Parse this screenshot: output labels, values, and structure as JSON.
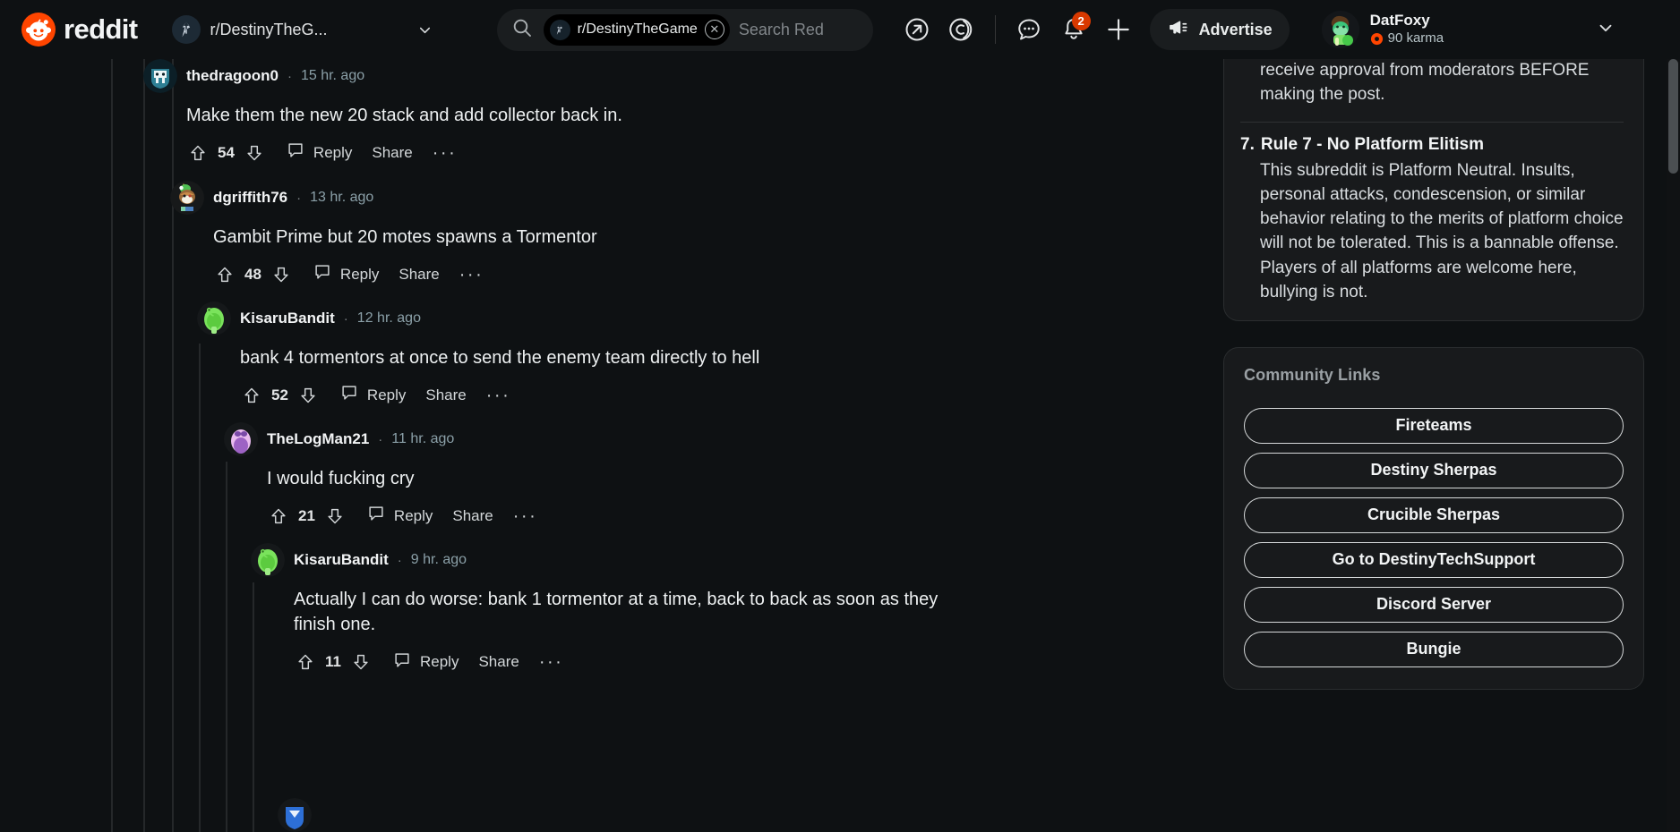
{
  "header": {
    "brand": "reddit",
    "community": {
      "name": "r/DestinyTheG...",
      "icon": "destiny-icon"
    },
    "search": {
      "pill_label": "r/DestinyTheGame",
      "placeholder": "Search Red",
      "value": ""
    },
    "icons": {
      "open_external": "external-link-icon",
      "reddit_coin": "reddit-coin-icon",
      "chat": "chat-bubble-icon",
      "notifications": "bell-icon",
      "create": "plus-icon"
    },
    "notifications_count": "2",
    "advertise_label": "Advertise",
    "user": {
      "name": "DatFoxy",
      "karma": "90 karma"
    }
  },
  "comments": [
    {
      "id": "c1",
      "author": "thedragoon0",
      "sep": "·",
      "time": "15 hr. ago",
      "body": "Make them the new 20 stack and add collector back in.",
      "score": "54",
      "reply_label": "Reply",
      "share_label": "Share",
      "more_label": "···",
      "depth": 0,
      "avatar_color": "#2a5b68"
    },
    {
      "id": "c2",
      "author": "dgriffith76",
      "sep": "·",
      "time": "13 hr. ago",
      "body": "Gambit Prime but 20 motes spawns a Tormentor",
      "score": "48",
      "reply_label": "Reply",
      "share_label": "Share",
      "more_label": "···",
      "depth": 1,
      "avatar_color": "#8a6038"
    },
    {
      "id": "c3",
      "author": "KisaruBandit",
      "sep": "·",
      "time": "12 hr. ago",
      "body": "bank 4 tormentors at once to send the enemy team directly to hell",
      "score": "52",
      "reply_label": "Reply",
      "share_label": "Share",
      "more_label": "···",
      "depth": 2,
      "avatar_color": "#7ae35c"
    },
    {
      "id": "c4",
      "author": "TheLogMan21",
      "sep": "·",
      "time": "11 hr. ago",
      "body": "I would fucking cry",
      "score": "21",
      "reply_label": "Reply",
      "share_label": "Share",
      "more_label": "···",
      "depth": 3,
      "avatar_color": "#e2a9e8"
    },
    {
      "id": "c5",
      "author": "KisaruBandit",
      "sep": "·",
      "time": "9 hr. ago",
      "body": "Actually I can do worse: bank 1 tormentor at a time, back to back as soon as they finish one.",
      "score": "11",
      "reply_label": "Reply",
      "share_label": "Share",
      "more_label": "···",
      "depth": 4,
      "avatar_color": "#7ae35c"
    }
  ],
  "sidebar": {
    "rules": {
      "continuation": "receive approval from moderators BEFORE making the post.",
      "item": {
        "number": "7.",
        "title": "Rule 7 - No Platform Elitism",
        "text": "This subreddit is Platform Neutral. Insults, personal attacks, condescension, or similar behavior relating to the merits of platform choice will not be tolerated. This is a bannable offense. Players of all platforms are welcome here, bullying is not."
      }
    },
    "community_links": {
      "title": "Community Links",
      "items": [
        "Fireteams",
        "Destiny Sherpas",
        "Crucible Sherpas",
        "Go to DestinyTechSupport",
        "Discord Server",
        "Bungie"
      ]
    }
  },
  "colors": {
    "brand": "#ff4500",
    "badge": "#d93900",
    "background": "#0e1113",
    "card": "#181a1c"
  }
}
